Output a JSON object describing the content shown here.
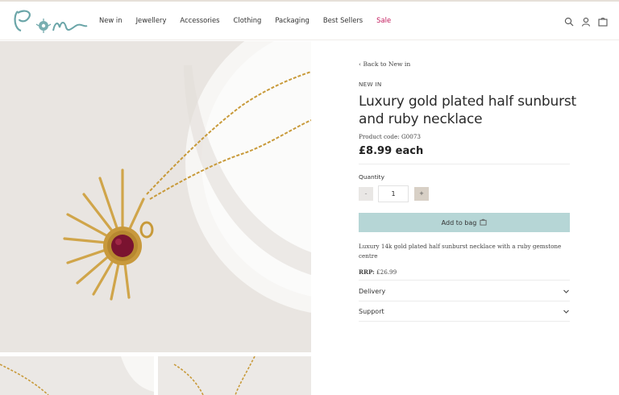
{
  "brand": {
    "logo_text": "Pom",
    "accent": "#6aa5a8"
  },
  "nav": {
    "items": [
      "New in",
      "Jewellery",
      "Accessories",
      "Clothing",
      "Packaging",
      "Best Sellers",
      "Sale"
    ],
    "sale_color": "#c2185b"
  },
  "header_icons": [
    "search-icon",
    "account-icon",
    "bag-icon"
  ],
  "product": {
    "back_link": "Back to New in",
    "eyebrow": "NEW IN",
    "title": "Luxury gold plated half sunburst and ruby necklace",
    "code": "Product code: G0073",
    "price": "£8.99 each",
    "quantity_label": "Quantity",
    "quantity_value": "1",
    "minus_label": "-",
    "plus_label": "+",
    "add_to_bag": "Add to bag",
    "add_button_color": "#b6d6d6",
    "description": "Luxury 14k gold plated half sunburst necklace with a ruby gemstone centre",
    "rrp_label": "RRP:",
    "rrp_value": "£26.99"
  },
  "accordions": [
    "Delivery",
    "Support"
  ]
}
